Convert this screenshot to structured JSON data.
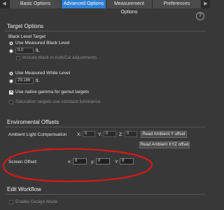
{
  "tabs": [
    {
      "label": "Basic Options",
      "active": false
    },
    {
      "label": "Advanced Options",
      "active": true
    },
    {
      "label": "Measurement Options",
      "active": false
    },
    {
      "label": "Preferences",
      "active": false
    }
  ],
  "help_icon": "?",
  "target_options": {
    "title": "Target Options",
    "black_level": {
      "heading": "Black Level Target",
      "use_measured_label": "Use Measured Black Level",
      "value": "0.0",
      "unit": "fL",
      "include_black_label": "Include black in AutoCal adjustments"
    },
    "white_level": {
      "use_measured_label": "Use Measured White Level",
      "value": "29.186",
      "unit": "fL"
    },
    "native_gamma_label": "Use native gamma for gamut targets",
    "saturation_label": "Saturation targets use constant luminance"
  },
  "environmental_offsets": {
    "title": "Enviromental Offsets",
    "ambient": {
      "label": "Ambient Light Compensation",
      "x_label": "X:",
      "x_value": "0",
      "y_label": "Y:",
      "y_value": "0",
      "z_label": "Z:",
      "z_value": "0",
      "read_y_button": "Read Ambient Y offset",
      "read_xyz_button": "Read Ambient XYZ offset"
    },
    "screen": {
      "label": "Screen Offset:",
      "x_label": "x:",
      "x_value": "0",
      "y_label": "y:",
      "y_value": "0",
      "Y_label": "Y:",
      "Y_value": "0"
    }
  },
  "edit_workflow": {
    "title": "Edit Workflow",
    "design_mode_label": "Enable Design Mode"
  },
  "colors": {
    "accent": "#2f7fd2",
    "annotation": "#d81818",
    "background": "#383838"
  }
}
